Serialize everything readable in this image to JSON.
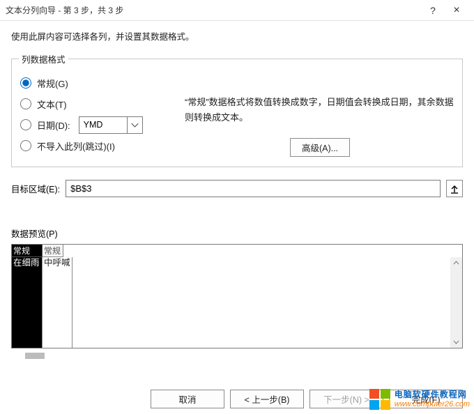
{
  "window": {
    "title": "文本分列向导 - 第 3 步，共 3 步",
    "help_symbol": "?",
    "close_symbol": "×"
  },
  "instruction": "使用此屏内容可选择各列，并设置其数据格式。",
  "format_group": {
    "legend": "列数据格式",
    "radios": {
      "general": "常规(G)",
      "text": "文本(T)",
      "date": "日期(D):",
      "skip": "不导入此列(跳过)(I)"
    },
    "date_value": "YMD",
    "description": "“常规”数据格式将数值转换成数字，日期值会转换成日期，其余数据则转换成文本。",
    "advanced_label": "高级(A)..."
  },
  "destination": {
    "label": "目标区域(E):",
    "value": "$B$3"
  },
  "preview": {
    "label": "数据预览(P)",
    "headers": [
      "常规",
      "常规"
    ],
    "row": [
      "在细雨",
      "中呼喊"
    ]
  },
  "footer": {
    "cancel": "取消",
    "back": "< 上一步(B)",
    "next": "下一步(N) >",
    "finish": "完成(F)"
  },
  "watermark": {
    "line1": "电脑软硬件教程网",
    "line2": "www.computer26.com"
  }
}
